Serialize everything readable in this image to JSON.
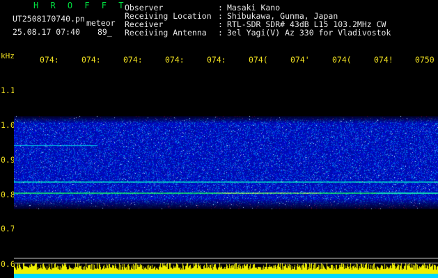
{
  "header": {
    "app_title": "H R O F F T",
    "filename": "UT2508170740.pn",
    "meteor_label": "meteor",
    "datetime": "25.08.17 07:40",
    "count": "89_"
  },
  "info": [
    {
      "key": "Observer",
      "sep": ":",
      "value": "Masaki Kano"
    },
    {
      "key": "Receiving Location",
      "sep": ":",
      "value": "Shibukawa, Gunma, Japan"
    },
    {
      "key": "Receiver",
      "sep": ":",
      "value": "RTL-SDR SDR# 43dB L15 103.2MHz CW"
    },
    {
      "key": "Receiving Antenna",
      "sep": ":",
      "value": "3el Yagi(V) Az 330 for Vladivostok"
    }
  ],
  "axis": {
    "y_unit": "kHz",
    "x_ticks": [
      "074:",
      "074:",
      "074:",
      "074:",
      "074:",
      "074(",
      "074'",
      "074(",
      "074!",
      "0750"
    ],
    "y_ticks": [
      "1.1",
      "1.0",
      "0.9",
      "0.8",
      "0.7",
      "0.6"
    ]
  },
  "colors": {
    "header_green": "#00e040",
    "tick_yellow": "#f0e020",
    "text_white": "#e8e8e8",
    "background": "#000000"
  }
}
